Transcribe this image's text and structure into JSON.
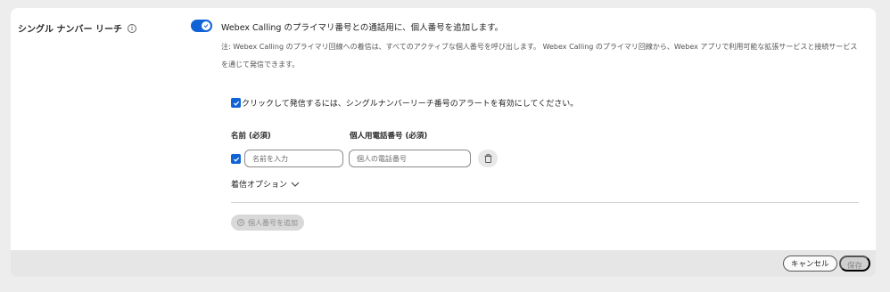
{
  "section": {
    "title": "シングル ナンバー リーチ",
    "info_glyph": "i"
  },
  "toggle": {
    "state": "on",
    "label": "Webex Calling のプライマリ番号との通話用に、個人番号を追加します。",
    "accent_color": "#0f63d6"
  },
  "note": "注: Webex Calling のプライマリ回線への着信は、すべてのアクティブな個人番号を呼び出します。 Webex Calling のプライマリ回線から、Webex アプリで利用可能な拡張サービスと接続サービスを通じて発信できます。",
  "alert_checkbox": {
    "checked": true,
    "label": "クリックして発信するには、シングルナンバーリーチ番号のアラートを有効にしてください。"
  },
  "fields": {
    "name_label": "名前 (必須)",
    "phone_label": "個人用電話番号 (必須)",
    "name_placeholder": "名前を入力",
    "phone_placeholder": "個人の電話番号",
    "row_checked": true
  },
  "options": {
    "label": "着信オプション",
    "icon": "chevron-down-icon"
  },
  "add_number": {
    "label": "個人番号を追加",
    "icon": "plus-circle-icon"
  },
  "footer": {
    "cancel_label": "キャンセル",
    "save_label": "保存"
  }
}
